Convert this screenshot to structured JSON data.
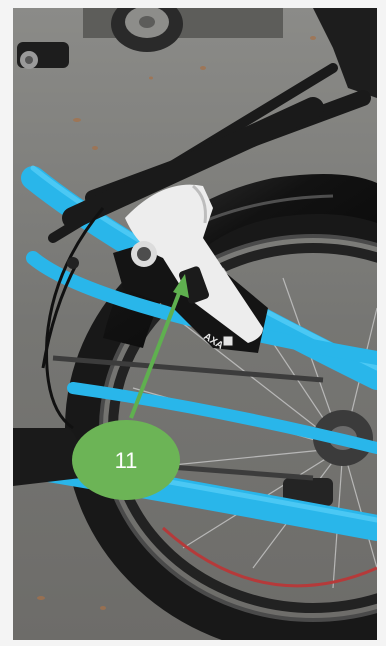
{
  "photo": {
    "subject": "bicycle",
    "colors": {
      "frame": "#29b6ea",
      "frame_shadow": "#1c8fc0",
      "tire": "#1d1d1d",
      "fender": "#151515",
      "lock_body": "#ececec",
      "ground": "#7d7d7a"
    }
  },
  "lock": {
    "brand_label": "AXA"
  },
  "callout": {
    "number": "11",
    "bubble_color": "#6cb456",
    "arrow_color": "#5fb04f"
  }
}
